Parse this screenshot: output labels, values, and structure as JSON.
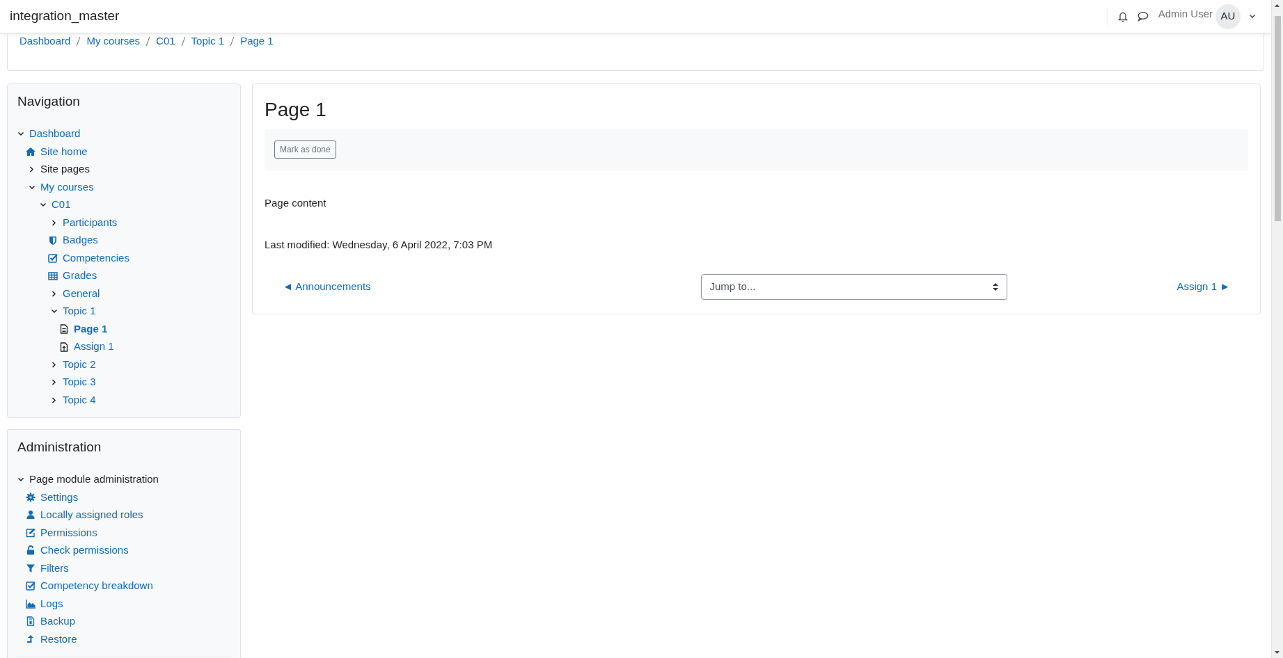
{
  "navbar": {
    "site_name": "integration_master",
    "user_name": "Admin User",
    "avatar_initials": "AU"
  },
  "breadcrumb": [
    "Dashboard",
    "My courses",
    "C01",
    "Topic 1",
    "Page 1"
  ],
  "navigation": {
    "title": "Navigation",
    "items": [
      {
        "label": "Dashboard",
        "kind": "branch",
        "linked": true,
        "expanded": true,
        "selected": false,
        "children": [
          {
            "label": "Site home",
            "kind": "home",
            "selected": false
          },
          {
            "label": "Site pages",
            "kind": "branch",
            "linked": false,
            "expanded": false,
            "selected": false
          },
          {
            "label": "My courses",
            "kind": "branch",
            "linked": true,
            "expanded": true,
            "selected": false,
            "children": [
              {
                "label": "C01",
                "kind": "branch",
                "linked": true,
                "expanded": true,
                "selected": false,
                "children": [
                  {
                    "label": "Participants",
                    "kind": "branch",
                    "linked": true,
                    "expanded": false,
                    "selected": false
                  },
                  {
                    "label": "Badges",
                    "kind": "shield",
                    "selected": false
                  },
                  {
                    "label": "Competencies",
                    "kind": "check",
                    "selected": false
                  },
                  {
                    "label": "Grades",
                    "kind": "table",
                    "selected": false
                  },
                  {
                    "label": "General",
                    "kind": "branch",
                    "linked": true,
                    "expanded": false,
                    "selected": false
                  },
                  {
                    "label": "Topic 1",
                    "kind": "branch",
                    "linked": true,
                    "expanded": true,
                    "selected": false,
                    "children": [
                      {
                        "label": "Page 1",
                        "kind": "page",
                        "selected": true
                      },
                      {
                        "label": "Assign 1",
                        "kind": "assign",
                        "selected": false
                      }
                    ]
                  },
                  {
                    "label": "Topic 2",
                    "kind": "branch",
                    "linked": true,
                    "expanded": false,
                    "selected": false
                  },
                  {
                    "label": "Topic 3",
                    "kind": "branch",
                    "linked": true,
                    "expanded": false,
                    "selected": false
                  },
                  {
                    "label": "Topic 4",
                    "kind": "branch",
                    "linked": true,
                    "expanded": false,
                    "selected": false
                  }
                ]
              }
            ]
          }
        ]
      }
    ]
  },
  "administration": {
    "title": "Administration",
    "items": [
      {
        "label": "Page module administration",
        "kind": "branch",
        "linked": false,
        "expanded": true,
        "selected": false,
        "children": [
          {
            "label": "Settings",
            "kind": "gear",
            "selected": false
          },
          {
            "label": "Locally assigned roles",
            "kind": "user",
            "selected": false
          },
          {
            "label": "Permissions",
            "kind": "edit",
            "selected": false
          },
          {
            "label": "Check permissions",
            "kind": "unlock",
            "selected": false
          },
          {
            "label": "Filters",
            "kind": "filter",
            "selected": false
          },
          {
            "label": "Competency breakdown",
            "kind": "check",
            "selected": false
          },
          {
            "label": "Logs",
            "kind": "chart",
            "selected": false
          },
          {
            "label": "Backup",
            "kind": "archive",
            "selected": false
          },
          {
            "label": "Restore",
            "kind": "upload",
            "selected": false
          }
        ]
      }
    ]
  },
  "main": {
    "title": "Page 1",
    "completion_button": "Mark as done",
    "content": "Page content",
    "last_modified": "Last modified: Wednesday, 6 April 2022, 7:03 PM",
    "prev_link": "◄ Announcements",
    "jump_select": {
      "value": "Jump to..."
    },
    "next_link": "Assign 1 ►"
  }
}
